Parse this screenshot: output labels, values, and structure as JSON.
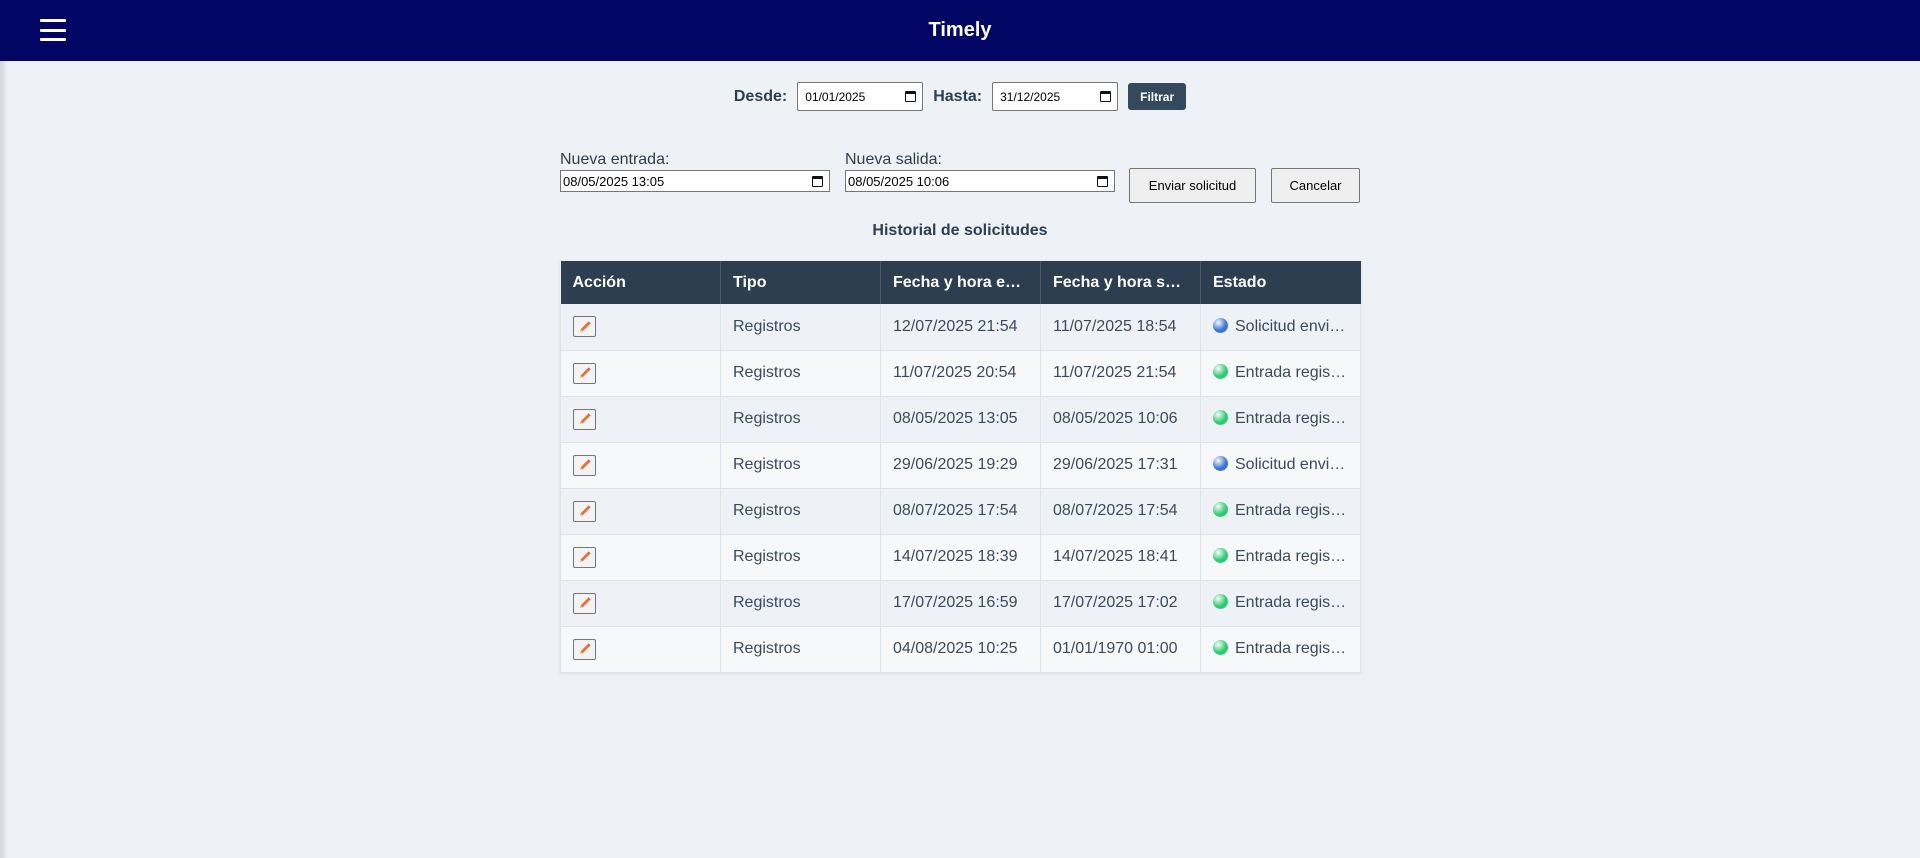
{
  "app": {
    "title": "Timely"
  },
  "filter": {
    "desde_label": "Desde:",
    "desde_value": "01/01/2025",
    "hasta_label": "Hasta:",
    "hasta_value": "31/12/2025",
    "filtrar_label": "Filtrar"
  },
  "request": {
    "entrada_label": "Nueva entrada:",
    "entrada_value": "08/05/2025 13:05",
    "salida_label": "Nueva salida:",
    "salida_value": "08/05/2025 10:06",
    "enviar_label": "Enviar solicitud",
    "cancelar_label": "Cancelar"
  },
  "history": {
    "title": "Historial de solicitudes",
    "columns": [
      "Acción",
      "Tipo",
      "Fecha y hora entrada",
      "Fecha y hora salida",
      "Estado"
    ],
    "rows": [
      {
        "tipo": "Registros",
        "entrada": "12/07/2025 21:54",
        "salida": "11/07/2025 18:54",
        "estado": "Solicitud enviada",
        "status_color": "#3a74d6"
      },
      {
        "tipo": "Registros",
        "entrada": "11/07/2025 20:54",
        "salida": "11/07/2025 21:54",
        "estado": "Entrada registrada",
        "status_color": "#2ecc71"
      },
      {
        "tipo": "Registros",
        "entrada": "08/05/2025 13:05",
        "salida": "08/05/2025 10:06",
        "estado": "Entrada registrada",
        "status_color": "#2ecc71"
      },
      {
        "tipo": "Registros",
        "entrada": "29/06/2025 19:29",
        "salida": "29/06/2025 17:31",
        "estado": "Solicitud enviada",
        "status_color": "#3a74d6"
      },
      {
        "tipo": "Registros",
        "entrada": "08/07/2025 17:54",
        "salida": "08/07/2025 17:54",
        "estado": "Entrada registrada",
        "status_color": "#2ecc71"
      },
      {
        "tipo": "Registros",
        "entrada": "14/07/2025 18:39",
        "salida": "14/07/2025 18:41",
        "estado": "Entrada registrada",
        "status_color": "#2ecc71"
      },
      {
        "tipo": "Registros",
        "entrada": "17/07/2025 16:59",
        "salida": "17/07/2025 17:02",
        "estado": "Entrada registrada",
        "status_color": "#2ecc71"
      },
      {
        "tipo": "Registros",
        "entrada": "04/08/2025 10:25",
        "salida": "01/01/1970 01:00",
        "estado": "Entrada registrada",
        "status_color": "#2ecc71"
      }
    ]
  },
  "icons": {
    "menu": "hamburger-menu-icon",
    "edit": "pencil-icon",
    "calendar": "calendar-icon"
  },
  "colors": {
    "header_bg": "#020563",
    "table_header_bg": "#2c3e50",
    "accent_button": "#34495e"
  }
}
